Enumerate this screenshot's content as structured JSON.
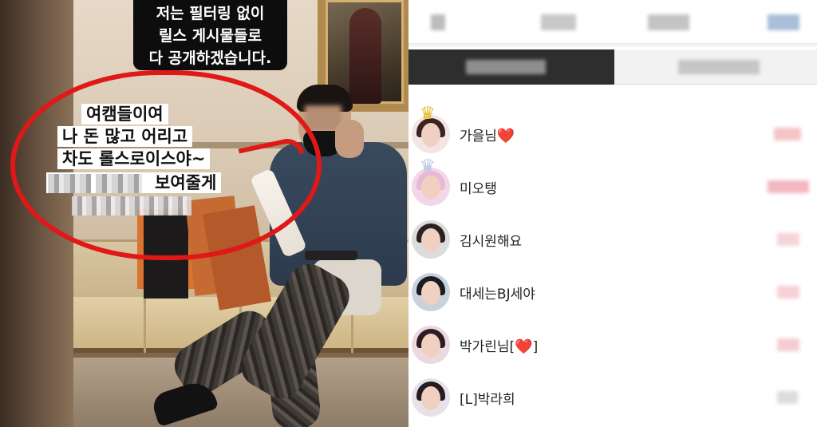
{
  "story": {
    "caption": "저는 필터링 없이\n릴스 게시물들로\n다 공개하겠습니다.",
    "overlay": {
      "line1": "여캠들이여",
      "line2": "나 돈 많고 어리고",
      "line3": "차도 롤스로이스야~",
      "line4": "보여줄게"
    },
    "colors": {
      "circle": "#e01818",
      "caption_bg": "#0d0d0d"
    }
  },
  "ranking": {
    "rows": [
      {
        "name": "가을님",
        "heart": "❤️",
        "crown": "♛",
        "score_color": "#f4c4c8"
      },
      {
        "name": "미오탱",
        "heart": "",
        "crown": "♛",
        "score_color": "#f2b7bf"
      },
      {
        "name": "김시원해요",
        "heart": "",
        "crown": "",
        "score_color": "#f6d3d6"
      },
      {
        "name": "대세는BJ세야",
        "heart": "",
        "crown": "",
        "score_color": "#f6d0d4"
      },
      {
        "name": "박가린님[",
        "heart": "❤️",
        "suffix": "]",
        "crown": "",
        "score_color": "#f5cdd1"
      },
      {
        "name": "[L]박라희",
        "heart": "",
        "crown": "",
        "score_color": "#dcdcdc"
      }
    ],
    "accent": "#e0202a"
  }
}
